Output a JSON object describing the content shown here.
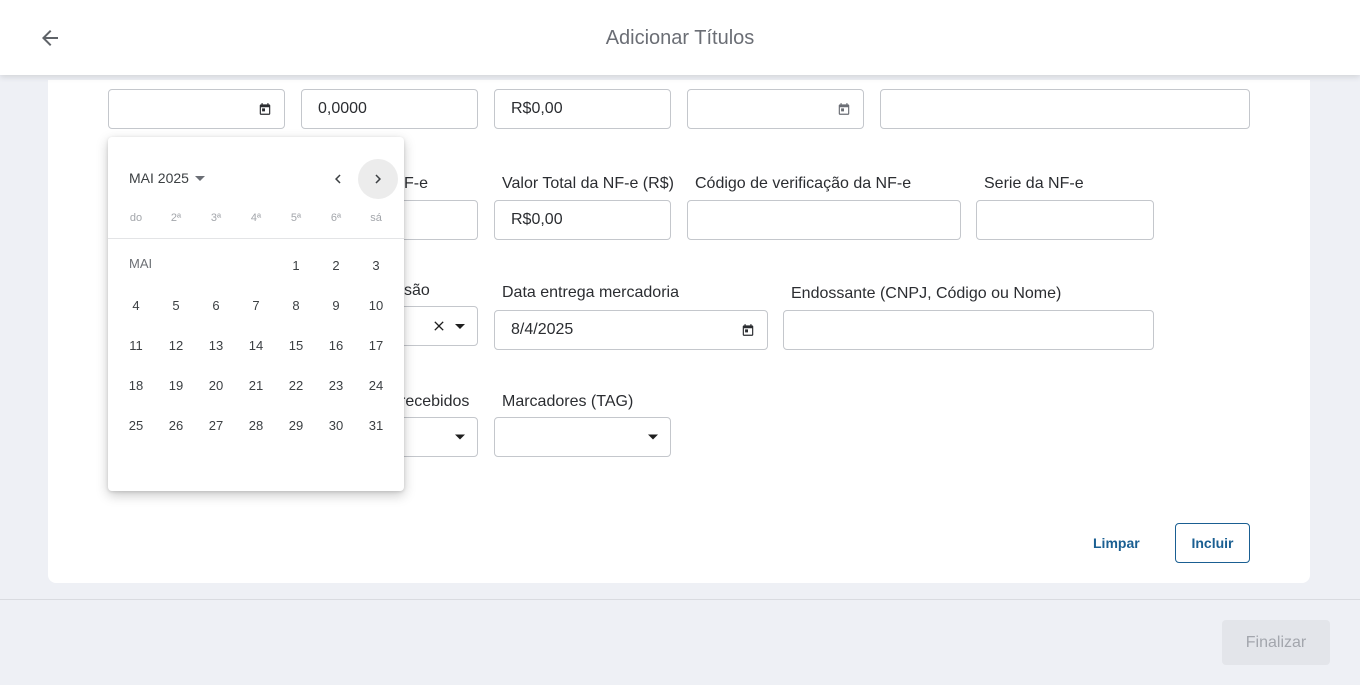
{
  "header": {
    "title": "Adicionar Títulos",
    "back_icon": "arrow-left-icon"
  },
  "form": {
    "row1": {
      "field1_value": "",
      "field2_value": "0,0000",
      "field3_value": "R$0,00",
      "field4_value": "",
      "field5_value": ""
    },
    "row2": {
      "label_partial": "F-e",
      "nfe_total_label": "Valor Total da NF-e (R$)",
      "nfe_total_value": "R$0,00",
      "nfe_code_label": "Código de verificação da NF-e",
      "nfe_code_value": "",
      "nfe_series_label": "Serie da NF-e",
      "nfe_series_value": ""
    },
    "row3": {
      "label_partial": "são",
      "delivery_label": "Data entrega mercadoria",
      "delivery_value": "8/4/2025",
      "endorser_label": "Endossante (CNPJ, Código ou Nome)",
      "endorser_value": ""
    },
    "row4": {
      "label_partial": "recebidos",
      "tags_label": "Marcadores (TAG)",
      "tags_value": ""
    }
  },
  "actions": {
    "clear_label": "Limpar",
    "include_label": "Incluir",
    "finish_label": "Finalizar"
  },
  "datepicker": {
    "month_year": "MAI 2025",
    "month_short": "MAI",
    "weekdays": [
      "do",
      "2ª",
      "3ª",
      "4ª",
      "5ª",
      "6ª",
      "sá"
    ],
    "first_weekday_index": 4,
    "days": [
      "1",
      "2",
      "3",
      "4",
      "5",
      "6",
      "7",
      "8",
      "9",
      "10",
      "11",
      "12",
      "13",
      "14",
      "15",
      "16",
      "17",
      "18",
      "19",
      "20",
      "21",
      "22",
      "23",
      "24",
      "25",
      "26",
      "27",
      "28",
      "29",
      "30",
      "31"
    ]
  }
}
